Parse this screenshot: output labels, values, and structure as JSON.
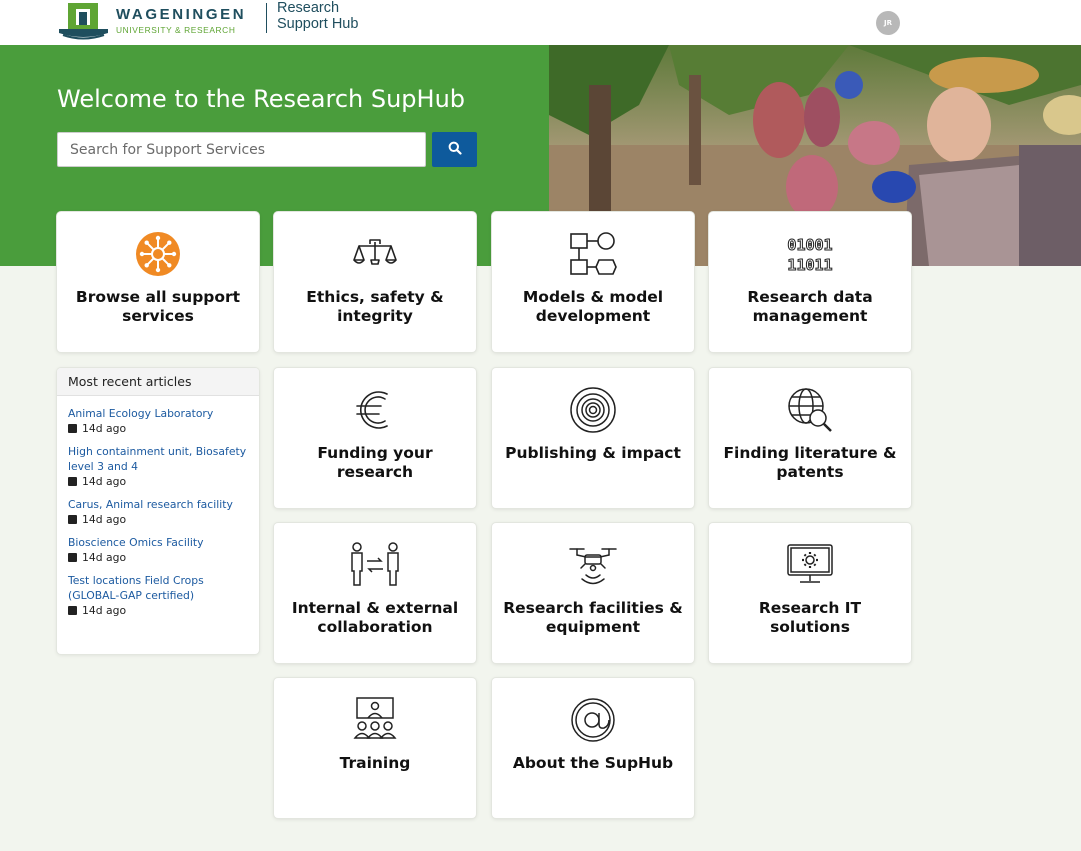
{
  "brand": {
    "name": "WAGENINGEN",
    "sub": "UNIVERSITY & RESEARCH",
    "hub_line1": "Research",
    "hub_line2": "Support Hub"
  },
  "user": {
    "initials": "JR"
  },
  "hero": {
    "title": "Welcome to the Research SupHub",
    "search_placeholder": "Search for Support Services"
  },
  "tiles": [
    {
      "label": "Browse all support services",
      "icon": "virus-asterisk-icon"
    },
    {
      "label": "Ethics, safety & integrity",
      "icon": "scales-icon"
    },
    {
      "label": "Models & model development",
      "icon": "flowchart-icon"
    },
    {
      "label": "Research data management",
      "icon": "binary-icon"
    },
    {
      "label": "Funding your research",
      "icon": "euro-icon"
    },
    {
      "label": "Publishing & impact",
      "icon": "target-icon"
    },
    {
      "label": "Finding literature & patents",
      "icon": "globe-search-icon"
    },
    {
      "label": "Internal & external collaboration",
      "icon": "people-exchange-icon"
    },
    {
      "label": "Research facilities & equipment",
      "icon": "drone-icon"
    },
    {
      "label": "Research IT solutions",
      "icon": "monitor-gear-icon"
    },
    {
      "label": "Training",
      "icon": "classroom-icon"
    },
    {
      "label": "About the SupHub",
      "icon": "at-sign-icon"
    }
  ],
  "recent": {
    "heading": "Most recent articles",
    "articles": [
      {
        "title": "Animal Ecology Laboratory",
        "age": "14d ago"
      },
      {
        "title": "High containment unit, Biosafety level 3 and 4",
        "age": "14d ago"
      },
      {
        "title": "Carus, Animal research facility",
        "age": "14d ago"
      },
      {
        "title": "Bioscience Omics Facility",
        "age": "14d ago"
      },
      {
        "title": "Test locations Field Crops (GLOBAL-GAP certified)",
        "age": "14d ago"
      }
    ]
  },
  "colors": {
    "hero_green": "#4a9d3c",
    "search_blue": "#0e5a9c",
    "brand_teal": "#1f4e5e",
    "brand_green": "#5fa534",
    "link_blue": "#1c5aa0",
    "accent_orange": "#f08a24"
  }
}
